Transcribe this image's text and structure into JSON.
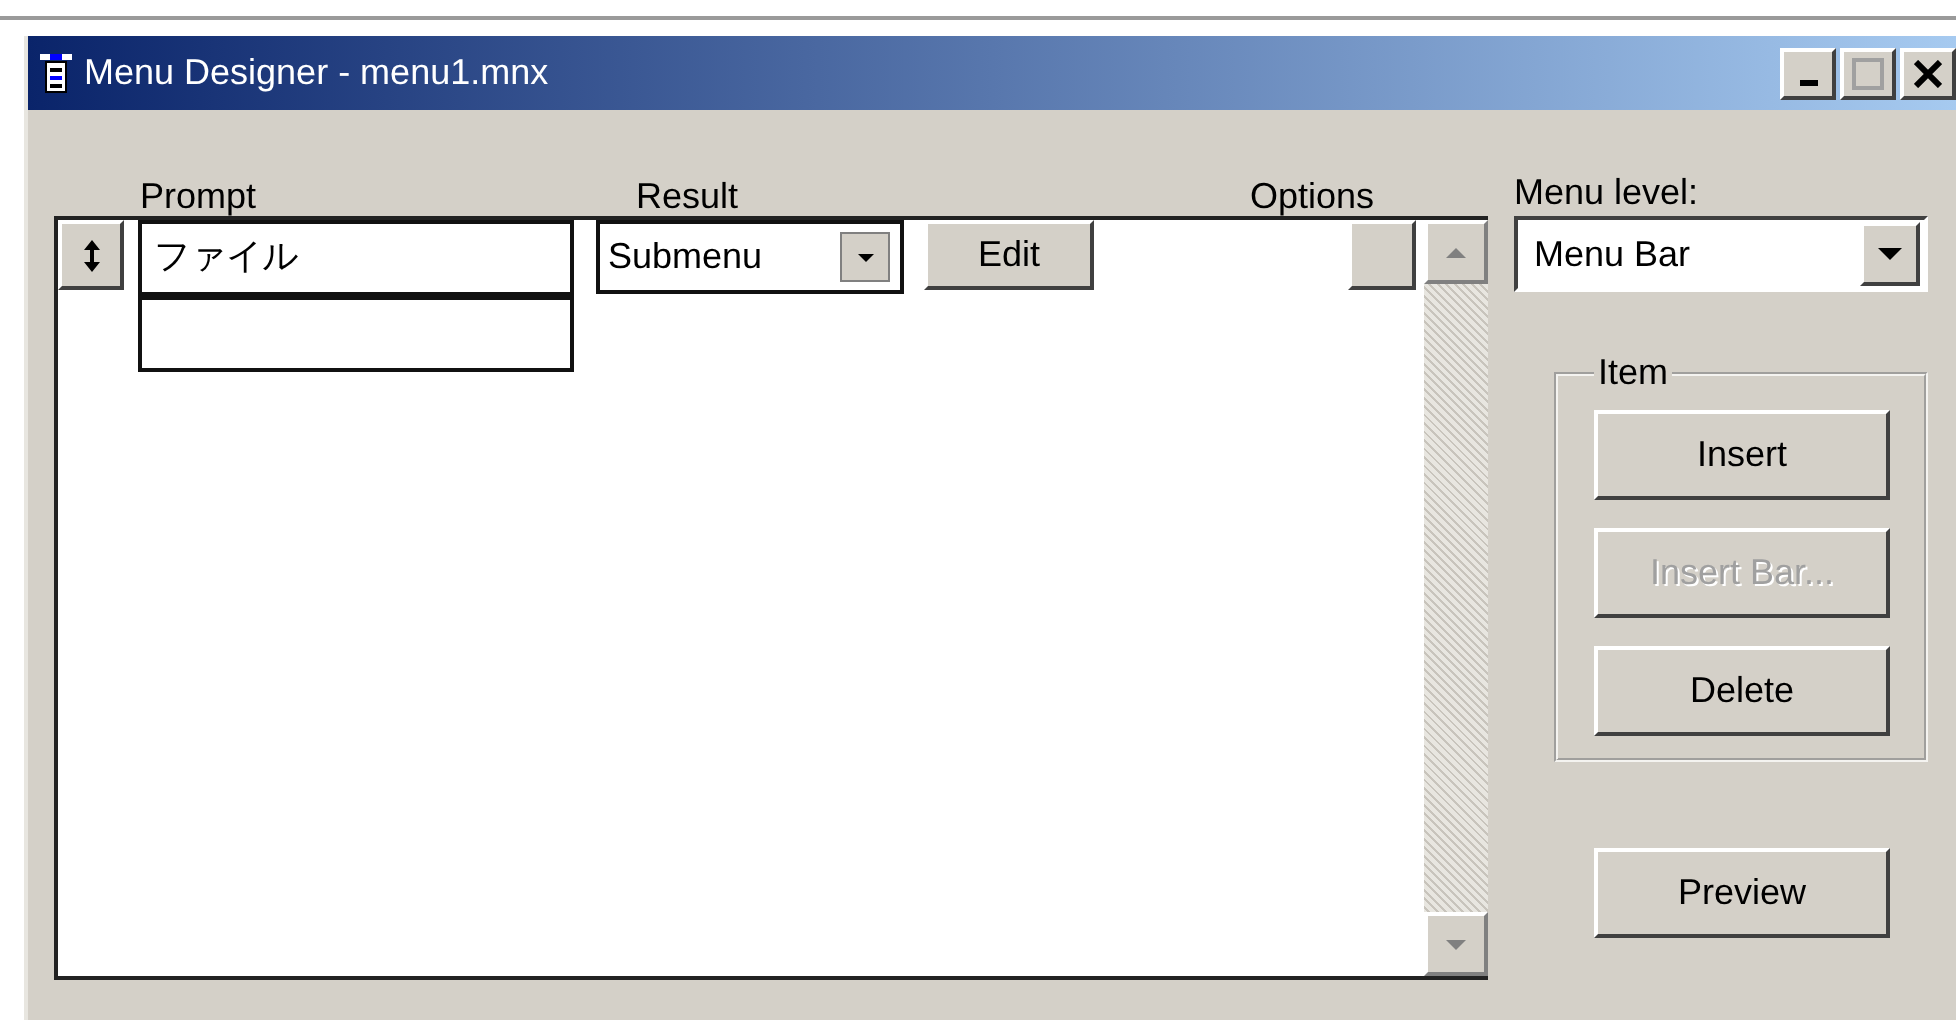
{
  "window": {
    "title": "Menu Designer - menu1.mnx"
  },
  "columns": [
    "Prompt",
    "Result",
    "Options"
  ],
  "rows": [
    {
      "kind": "item",
      "prompt": "ファイル",
      "result": "Submenu",
      "edit_button": "Edit"
    },
    {
      "kind": "new"
    }
  ],
  "menu_level": {
    "label": "Menu level:",
    "value": "Menu Bar"
  },
  "item_group": {
    "title": "Item",
    "buttons": [
      {
        "label": "Insert",
        "disabled": false
      },
      {
        "label": "Insert Bar...",
        "disabled": true
      },
      {
        "label": "Delete",
        "disabled": false
      }
    ]
  },
  "preview_button": {
    "label": "Preview"
  }
}
